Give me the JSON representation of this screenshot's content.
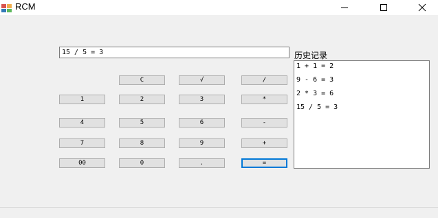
{
  "window": {
    "title": "RCM",
    "controls": [
      "minimize-icon",
      "maximize-icon",
      "close-icon"
    ]
  },
  "display": {
    "value": "15 / 5 = 3"
  },
  "history": {
    "label": "历史记录",
    "items": [
      "1 + 1 = 2",
      "9 - 6 = 3",
      "2 * 3 = 6",
      "15 / 5 = 3"
    ]
  },
  "keys": {
    "clear": "C",
    "sqrt": "√",
    "divide": "/",
    "k1": "1",
    "k2": "2",
    "k3": "3",
    "multiply": "*",
    "k4": "4",
    "k5": "5",
    "k6": "6",
    "minus": "-",
    "k7": "7",
    "k8": "8",
    "k9": "9",
    "plus": "+",
    "k00": "00",
    "k0": "0",
    "dot": ".",
    "equals": "="
  },
  "colors": {
    "focus_border": "#0078d7",
    "button_face": "#e1e1e1"
  }
}
